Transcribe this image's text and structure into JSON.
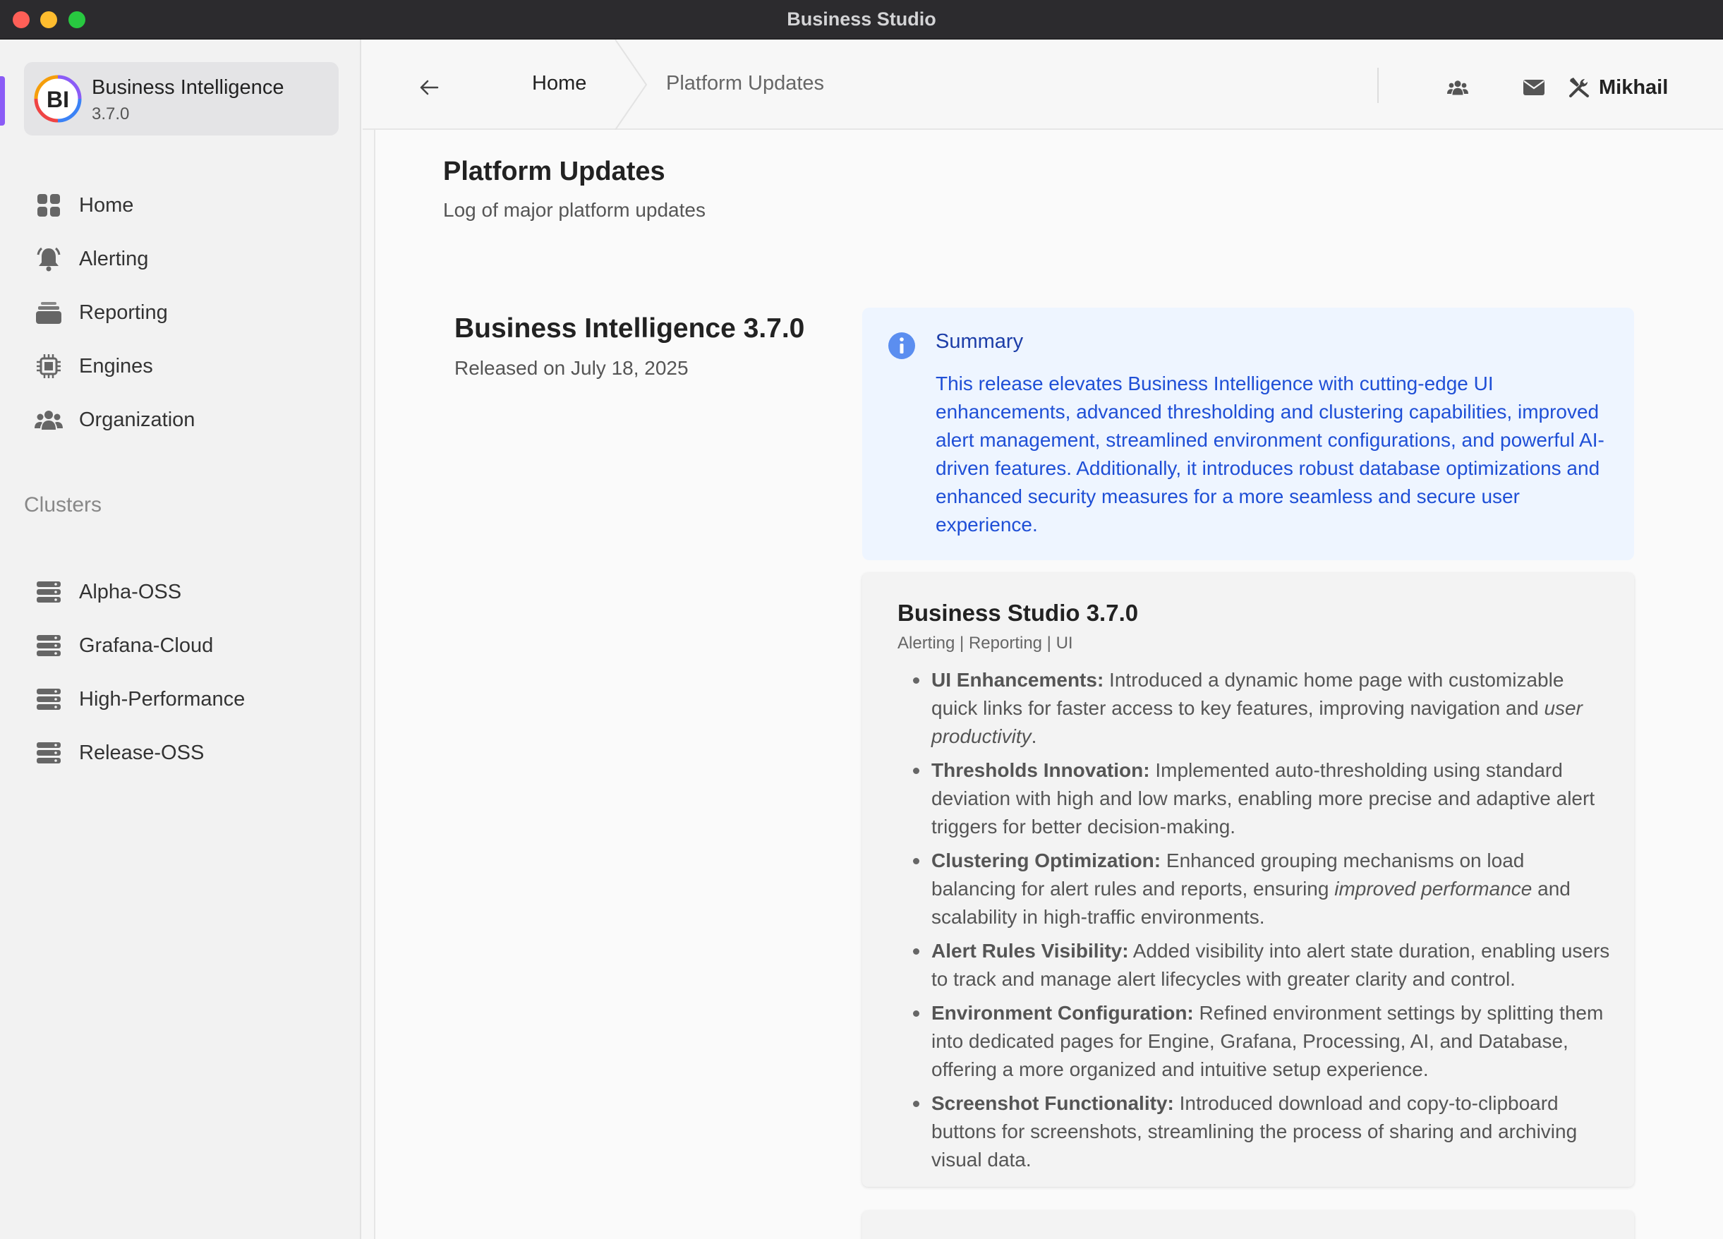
{
  "window": {
    "title": "Business Studio"
  },
  "app": {
    "name": "Business Intelligence",
    "version": "3.7.0",
    "logo_text": "BI"
  },
  "sidebar": {
    "items": [
      {
        "label": "Home",
        "icon": "grid-icon"
      },
      {
        "label": "Alerting",
        "icon": "bell-icon"
      },
      {
        "label": "Reporting",
        "icon": "layers-icon"
      },
      {
        "label": "Engines",
        "icon": "chip-icon"
      },
      {
        "label": "Organization",
        "icon": "users-icon"
      }
    ],
    "clusters_label": "Clusters",
    "clusters": [
      {
        "label": "Alpha-OSS",
        "icon": "server-icon"
      },
      {
        "label": "Grafana-Cloud",
        "icon": "server-icon"
      },
      {
        "label": "High-Performance",
        "icon": "server-icon"
      },
      {
        "label": "Release-OSS",
        "icon": "server-icon"
      }
    ]
  },
  "header": {
    "breadcrumb_home": "Home",
    "breadcrumb_current": "Platform Updates",
    "user_name": "Mikhail"
  },
  "page": {
    "title": "Platform Updates",
    "subtitle": "Log of major platform updates"
  },
  "release": {
    "title": "Business Intelligence 3.7.0",
    "date": "Released on July 18, 2025",
    "summary_title": "Summary",
    "summary_text": "This release elevates Business Intelligence with cutting-edge UI enhancements, advanced thresholding and clustering capabilities, improved alert management, streamlined environment configurations, and powerful AI-driven features. Additionally, it introduces robust database optimizations and enhanced security measures for a more seamless and secure user experience."
  },
  "detail": {
    "title": "Business Studio 3.7.0",
    "tags": "Alerting | Reporting | UI",
    "items": [
      {
        "heading": "UI Enhancements:",
        "pre": " Introduced a dynamic home page with customizable quick links for faster access to key features, improving navigation and ",
        "em": "user productivity",
        "post": "."
      },
      {
        "heading": "Thresholds Innovation:",
        "pre": " Implemented auto-thresholding using standard deviation with high and low marks, enabling more precise and adaptive alert triggers for better decision-making.",
        "em": "",
        "post": ""
      },
      {
        "heading": "Clustering Optimization:",
        "pre": " Enhanced grouping mechanisms on load balancing for alert rules and reports, ensuring ",
        "em": "improved performance",
        "post": " and scalability in high-traffic environments."
      },
      {
        "heading": "Alert Rules Visibility:",
        "pre": " Added visibility into alert state duration, enabling users to track and manage alert lifecycles with greater clarity and control.",
        "em": "",
        "post": ""
      },
      {
        "heading": "Environment Configuration:",
        "pre": " Refined environment settings by splitting them into dedicated pages for Engine, Grafana, Processing, AI, and Database, offering a more organized and intuitive setup experience.",
        "em": "",
        "post": ""
      },
      {
        "heading": "Screenshot Functionality:",
        "pre": " Introduced download and copy-to-clipboard buttons for screenshots, streamlining the process of sharing and archiving visual data.",
        "em": "",
        "post": ""
      }
    ]
  },
  "colors": {
    "accent": "#8b5cf6",
    "summary_bg": "#eef5ff",
    "summary_text": "#1f4fd6",
    "info_icon": "#3b82f6"
  }
}
